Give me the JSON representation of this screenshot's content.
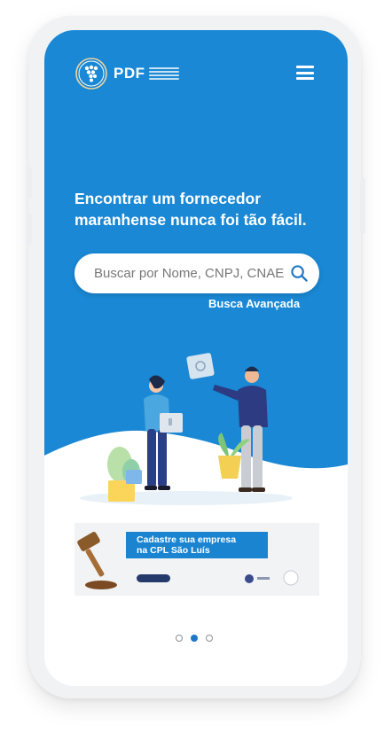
{
  "brand": {
    "name": "PDF",
    "logo_icon": "grape-cluster-logo-icon"
  },
  "header": {
    "menu_icon": "hamburger-menu-icon"
  },
  "hero": {
    "headline_line1": "Encontrar um fornecedor",
    "headline_line2": "maranhense nunca foi tão fácil."
  },
  "search": {
    "placeholder": "Buscar por Nome, CNPJ, CNAE",
    "value": "",
    "icon": "search-icon"
  },
  "advanced_search": {
    "label": "Busca Avançada"
  },
  "banner": {
    "title_line1": "Cadastre sua empresa",
    "title_line2": "na CPL São Luís"
  },
  "carousel": {
    "total": 3,
    "active_index": 1
  },
  "colors": {
    "hero_blue": "#1a88d4",
    "active_dot": "#1d76c6",
    "banner_stripe": "#1a84d1"
  }
}
